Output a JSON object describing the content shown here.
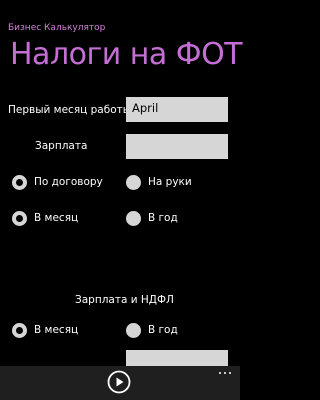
{
  "header": {
    "app_title": "Бизнес Калькулятор",
    "page_title": "Налоги на ФОТ"
  },
  "form": {
    "first_month_label": "Первый месяц работы",
    "first_month_value": "April",
    "salary_label": "Зарплата",
    "salary_value": "",
    "contract_option": "По договору",
    "net_option": "На руки",
    "monthly_option": "В месяц",
    "yearly_option": "В год",
    "selected_payment_type": "По договору",
    "selected_period": "В месяц"
  },
  "results": {
    "section_title": "Зарплата и НДФЛ",
    "monthly_option": "В месяц",
    "yearly_option": "В год",
    "selected_period": "В месяц"
  },
  "app_bar": {
    "play_icon": "play-circle-icon",
    "more_icon": "ellipsis-icon"
  },
  "colors": {
    "accent": "#c56fd6",
    "background": "#000000",
    "field": "#d6d6d6",
    "app_bar": "#1f1f1f"
  }
}
